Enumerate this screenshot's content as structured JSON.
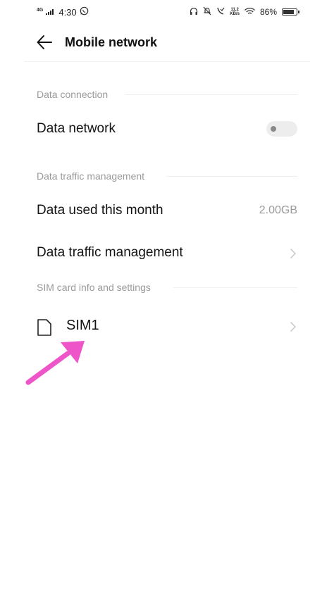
{
  "status_bar": {
    "network": "4G",
    "time": "4:30",
    "speed_value": "11.2",
    "speed_unit": "KB/s",
    "battery_percent": "86%",
    "battery_level": 0.86
  },
  "header": {
    "title": "Mobile network"
  },
  "sections": {
    "data_connection": {
      "header": "Data connection",
      "data_network_label": "Data network",
      "data_network_enabled": false
    },
    "traffic": {
      "header": "Data traffic management",
      "data_used_label": "Data used this month",
      "data_used_value": "2.00GB",
      "traffic_management_label": "Data traffic management"
    },
    "sim": {
      "header": "SIM card info and settings",
      "sim1_label": "SIM1"
    }
  },
  "colors": {
    "annotation_arrow": "#ee55c8",
    "section_header": "#9a9a9a"
  }
}
